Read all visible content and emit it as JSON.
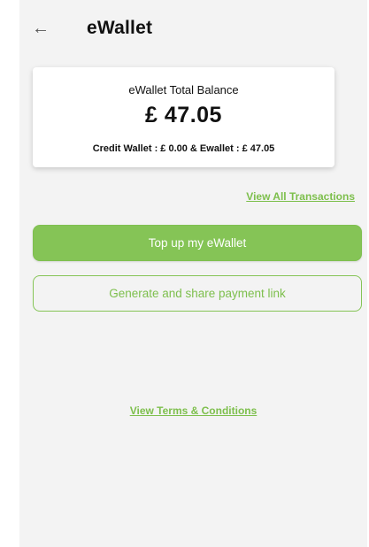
{
  "header": {
    "back_icon": "arrow-left-icon",
    "title": "eWallet"
  },
  "balance": {
    "label": "eWallet Total Balance",
    "amount": "£ 47.05",
    "breakdown": "Credit Wallet : £ 0.00 & Ewallet : £ 47.05"
  },
  "links": {
    "view_all": "View All Transactions",
    "terms": "View Terms & Conditions"
  },
  "buttons": {
    "top_up": "Top up my eWallet",
    "payment_link": "Generate and share payment link"
  },
  "colors": {
    "accent": "#85c456",
    "background": "#f3f3f3"
  }
}
